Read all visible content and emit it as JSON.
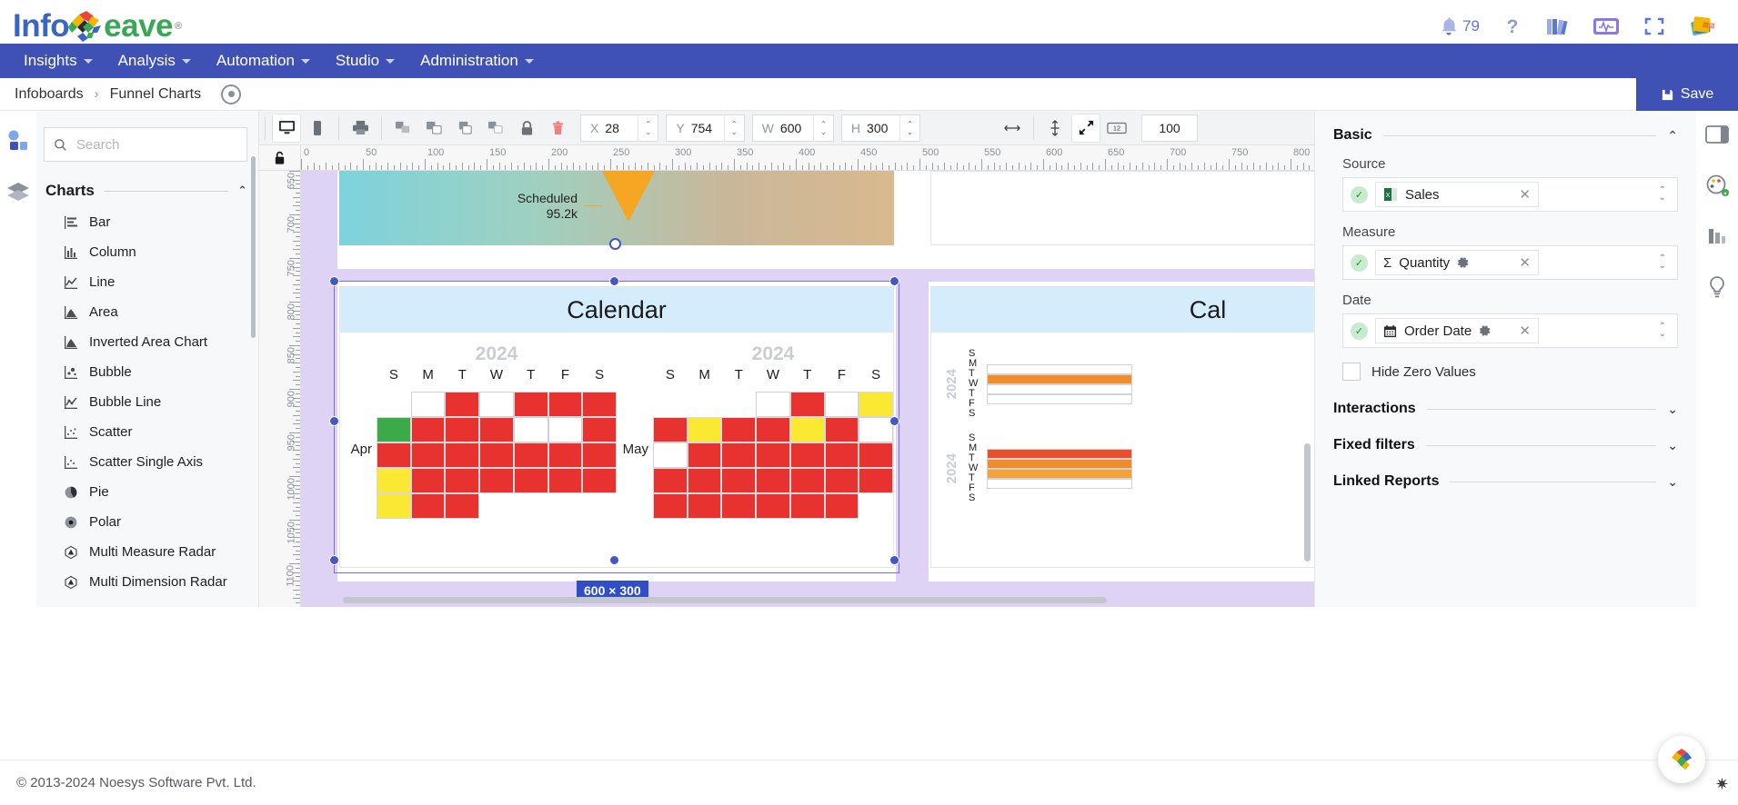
{
  "app": {
    "logo_info": "Info",
    "logo_eave": "eave",
    "logo_reg": "®"
  },
  "topbar": {
    "notification_count": "79",
    "icons": [
      {
        "name": "notifications-icon",
        "glyph": "bell"
      },
      {
        "name": "help-icon",
        "glyph": "?"
      },
      {
        "name": "library-icon",
        "glyph": "books"
      },
      {
        "name": "monitor-icon",
        "glyph": "pulse"
      },
      {
        "name": "fullscreen-icon",
        "glyph": "expand"
      },
      {
        "name": "apps-icon",
        "glyph": "cards"
      }
    ]
  },
  "nav": {
    "items": [
      {
        "label": "Insights"
      },
      {
        "label": "Analysis"
      },
      {
        "label": "Automation"
      },
      {
        "label": "Studio"
      },
      {
        "label": "Administration"
      }
    ]
  },
  "breadcrumb": {
    "root": "Infoboards",
    "separator": "›",
    "current": "Funnel Charts",
    "preview_tooltip": "Preview"
  },
  "save": {
    "label": "Save"
  },
  "palette": {
    "search_placeholder": "Search",
    "search_value": "",
    "section_title": "Charts",
    "items": [
      {
        "label": "Bar",
        "icon": "bar-chart-icon"
      },
      {
        "label": "Column",
        "icon": "column-chart-icon"
      },
      {
        "label": "Line",
        "icon": "line-chart-icon"
      },
      {
        "label": "Area",
        "icon": "area-chart-icon"
      },
      {
        "label": "Inverted Area Chart",
        "icon": "inverted-area-chart-icon"
      },
      {
        "label": "Bubble",
        "icon": "bubble-chart-icon"
      },
      {
        "label": "Bubble Line",
        "icon": "bubble-line-chart-icon"
      },
      {
        "label": "Scatter",
        "icon": "scatter-chart-icon"
      },
      {
        "label": "Scatter Single Axis",
        "icon": "scatter-single-axis-icon"
      },
      {
        "label": "Pie",
        "icon": "pie-chart-icon"
      },
      {
        "label": "Polar",
        "icon": "polar-chart-icon"
      },
      {
        "label": "Multi Measure Radar",
        "icon": "multi-measure-radar-icon"
      },
      {
        "label": "Multi Dimension Radar",
        "icon": "multi-dimension-radar-icon"
      }
    ]
  },
  "toolbar": {
    "device_buttons": [
      {
        "name": "desktop-view-button",
        "active": true
      },
      {
        "name": "mobile-view-button",
        "active": false
      },
      {
        "name": "print-view-button",
        "active": false
      }
    ],
    "arrange_buttons": [
      {
        "name": "bring-forward-button"
      },
      {
        "name": "bring-to-front-button"
      },
      {
        "name": "send-backward-button"
      },
      {
        "name": "send-to-back-button"
      },
      {
        "name": "lock-button"
      },
      {
        "name": "delete-button"
      }
    ],
    "fields": [
      {
        "label": "X",
        "value": "28"
      },
      {
        "label": "Y",
        "value": "754"
      },
      {
        "label": "W",
        "value": "600"
      },
      {
        "label": "H",
        "value": "300"
      }
    ],
    "align_buttons": [
      {
        "name": "align-horizontal-button"
      },
      {
        "name": "align-vertical-button"
      },
      {
        "name": "fit-to-screen-button",
        "active": true
      },
      {
        "name": "grid-size-button",
        "label": "12"
      }
    ],
    "zoom_value": "100"
  },
  "canvas": {
    "ruler_h_labels": [
      "0",
      "50",
      "100",
      "150",
      "200",
      "250",
      "300",
      "350",
      "400",
      "450",
      "500",
      "550",
      "600",
      "650",
      "700",
      "750",
      "800"
    ],
    "ruler_v_labels": [
      "650",
      "700",
      "750",
      "800",
      "850",
      "900",
      "950",
      "1000",
      "1050",
      "1100"
    ],
    "lock_icon": "lock-icon",
    "size_badge": "600 × 300",
    "funnel": {
      "label": "Scheduled",
      "value": "95.2k"
    },
    "calendar": {
      "title": "Calendar",
      "months": [
        {
          "year": "2024",
          "name": "Apr"
        },
        {
          "year": "2024",
          "name": "May"
        }
      ],
      "dow": [
        "S",
        "M",
        "T",
        "W",
        "T",
        "F",
        "S"
      ]
    },
    "calendar2": {
      "title": "Cal",
      "years": [
        "2024",
        "2024"
      ],
      "dow": [
        "S",
        "M",
        "T",
        "W",
        "T",
        "F",
        "S"
      ]
    }
  },
  "chart_data": {
    "type": "heatmap",
    "title": "Calendar",
    "subtitle": "",
    "xlabel": "",
    "ylabel": "",
    "legend_position": "none",
    "grid": true,
    "color_scale": {
      "red": "#e8322f",
      "yellow": "#fbe832",
      "green": "#3bab4a",
      "white": "#ffffff"
    },
    "measure": "Quantity",
    "date_field": "Order Date",
    "source": "Sales",
    "categories": [
      "S",
      "M",
      "T",
      "W",
      "T",
      "F",
      "S"
    ],
    "series": [
      {
        "name": "Apr 2024",
        "weeks": [
          [
            "none",
            "white",
            "red",
            "white",
            "red",
            "red",
            "red"
          ],
          [
            "green",
            "red",
            "red",
            "red",
            "white",
            "white",
            "red"
          ],
          [
            "red",
            "red",
            "red",
            "red",
            "red",
            "red",
            "red"
          ],
          [
            "yellow",
            "red",
            "red",
            "red",
            "red",
            "red",
            "red"
          ],
          [
            "yellow",
            "red",
            "red",
            "none",
            "none",
            "none",
            "none"
          ]
        ]
      },
      {
        "name": "May 2024",
        "weeks": [
          [
            "none",
            "none",
            "none",
            "white",
            "red",
            "white",
            "yellow"
          ],
          [
            "red",
            "yellow",
            "red",
            "red",
            "yellow",
            "red",
            "white"
          ],
          [
            "white",
            "red",
            "red",
            "red",
            "red",
            "red",
            "red"
          ],
          [
            "red",
            "red",
            "red",
            "red",
            "red",
            "red",
            "red"
          ],
          [
            "red",
            "red",
            "red",
            "red",
            "red",
            "red",
            "none"
          ]
        ]
      }
    ]
  },
  "properties": {
    "basic": {
      "title": "Basic",
      "source_label": "Source",
      "source_value": "Sales",
      "measure_label": "Measure",
      "measure_value": "Quantity",
      "measure_prefix": "Σ",
      "date_label": "Date",
      "date_value": "Order Date",
      "hide_zero_label": "Hide Zero Values",
      "hide_zero_checked": false
    },
    "sections": [
      {
        "title": "Interactions"
      },
      {
        "title": "Fixed filters"
      },
      {
        "title": "Linked Reports"
      }
    ]
  },
  "footer": {
    "copyright": "© 2013-2024 Noesys Software Pvt. Ltd."
  }
}
